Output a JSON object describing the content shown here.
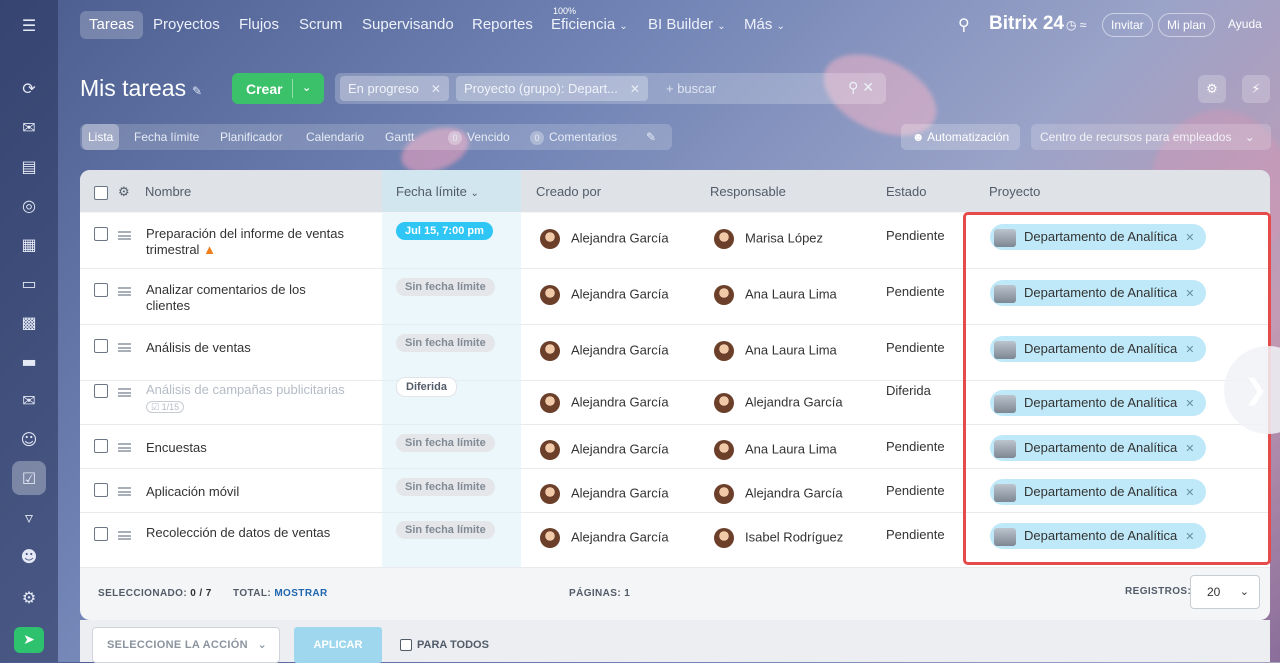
{
  "nav": {
    "items": [
      "Tareas",
      "Proyectos",
      "Flujos",
      "Scrum",
      "Supervisando",
      "Reportes",
      "Eficiencia",
      "BI Builder",
      "Más"
    ],
    "efficiency_badge": "100%",
    "brand": "Bitrix 24",
    "invite": "Invitar",
    "plan": "Mi plan",
    "help": "Ayuda"
  },
  "header": {
    "title": "Mis tareas",
    "create_label": "Crear",
    "filter_chips": [
      "En progreso",
      "Proyecto (grupo): Depart..."
    ],
    "search_placeholder": "+ buscar"
  },
  "views": {
    "tabs": [
      "Lista",
      "Fecha límite",
      "Planificador",
      "Calendario",
      "Gantt"
    ],
    "overdue_count": "0",
    "overdue_label": "Vencido",
    "comments_count": "0",
    "comments_label": "Comentarios",
    "automation": "Automatización",
    "resource_center": "Centro de recursos para empleados"
  },
  "table": {
    "columns": [
      "Nombre",
      "Fecha límite",
      "Creado por",
      "Responsable",
      "Estado",
      "Proyecto"
    ],
    "rows": [
      {
        "name": "Preparación del informe de ventas trimestral",
        "deadline": "Jul 15, 7:00 pm",
        "creator": "Alejandra García",
        "responsible": "Marisa López",
        "status": "Pendiente",
        "project": "Departamento de Analítica"
      },
      {
        "name": "Analizar comentarios de los clientes",
        "deadline": "Sin fecha límite",
        "creator": "Alejandra García",
        "responsible": "Ana Laura Lima",
        "status": "Pendiente",
        "project": "Departamento de Analítica"
      },
      {
        "name": "Análisis de ventas",
        "deadline": "Sin fecha límite",
        "creator": "Alejandra García",
        "responsible": "Ana Laura Lima",
        "status": "Pendiente",
        "project": "Departamento de Analítica"
      },
      {
        "name": "Análisis de campañas publicitarias",
        "checklist": "1/15",
        "deadline": "Diferida",
        "creator": "Alejandra García",
        "responsible": "Alejandra García",
        "status": "Diferida",
        "project": "Departamento de Analítica"
      },
      {
        "name": "Encuestas",
        "deadline": "Sin fecha límite",
        "creator": "Alejandra García",
        "responsible": "Ana Laura Lima",
        "status": "Pendiente",
        "project": "Departamento de Analítica"
      },
      {
        "name": "Aplicación móvil",
        "deadline": "Sin fecha límite",
        "creator": "Alejandra García",
        "responsible": "Alejandra García",
        "status": "Pendiente",
        "project": "Departamento de Analítica"
      },
      {
        "name": "Recolección de datos de ventas",
        "deadline": "Sin fecha límite",
        "creator": "Alejandra García",
        "responsible": "Isabel Rodríguez",
        "status": "Pendiente",
        "project": "Departamento de Analítica"
      }
    ]
  },
  "footer": {
    "selected_label": "SELECCIONADO:",
    "selected_value": "0 / 7",
    "total_label": "TOTAL:",
    "total_link": "MOSTRAR",
    "pages_label": "PÁGINAS:",
    "pages_value": "1",
    "records_label": "REGISTROS:",
    "records_value": "20"
  },
  "actions": {
    "select_action": "SELECCIONE LA ACCIÓN",
    "apply": "APLICAR",
    "for_all": "PARA TODOS"
  },
  "colors": {
    "create_green": "#3bc16a",
    "deadline_blue": "#2fc6f6",
    "project_chip": "#bfe9f8",
    "highlight_red": "#e64b4b"
  }
}
